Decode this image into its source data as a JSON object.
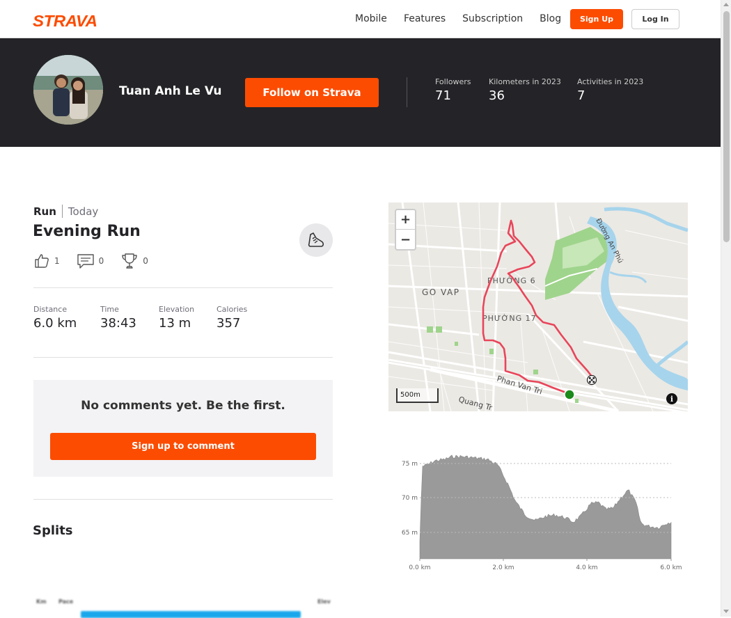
{
  "nav": {
    "logo": "STRAVA",
    "links": [
      "Mobile",
      "Features",
      "Subscription",
      "Blog"
    ],
    "signup": "Sign Up",
    "login": "Log In"
  },
  "athlete": {
    "name": "Tuan Anh Le Vu",
    "follow_button": "Follow on Strava",
    "stats": [
      {
        "label": "Followers",
        "value": "71"
      },
      {
        "label": "Kilometers in 2023",
        "value": "36"
      },
      {
        "label": "Activities in 2023",
        "value": "7"
      }
    ]
  },
  "activity": {
    "type": "Run",
    "date": "Today",
    "title": "Evening Run",
    "kudos": "1",
    "comments": "0",
    "achievements": "0",
    "metrics": [
      {
        "label": "Distance",
        "value": "6.0 km"
      },
      {
        "label": "Time",
        "value": "38:43"
      },
      {
        "label": "Elevation",
        "value": "13 m"
      },
      {
        "label": "Calories",
        "value": "357"
      }
    ]
  },
  "comments_box": {
    "message": "No comments yet. Be the first.",
    "button": "Sign up to comment"
  },
  "splits": {
    "title": "Splits",
    "headers": [
      "Km",
      "Pace",
      "Elev"
    ]
  },
  "map": {
    "zoom_in": "+",
    "zoom_out": "−",
    "scale": "500m",
    "info": "i",
    "labels": [
      "GO VAP",
      "PHƯỜNG 6",
      "PHƯỜNG 17",
      "Phan Van Tri",
      "Quang Tr",
      "Đường An Phú"
    ],
    "route_color": "#e8455a",
    "start_color": "#1a8a1a"
  },
  "elevation": {
    "y_ticks": [
      "75 m",
      "70 m",
      "65 m"
    ],
    "x_ticks": [
      "0.0 km",
      "2.0 km",
      "4.0 km",
      "6.0 km"
    ],
    "fill_color": "#999999"
  },
  "colors": {
    "brand": "#fc4c02",
    "header_bg": "#242428"
  }
}
